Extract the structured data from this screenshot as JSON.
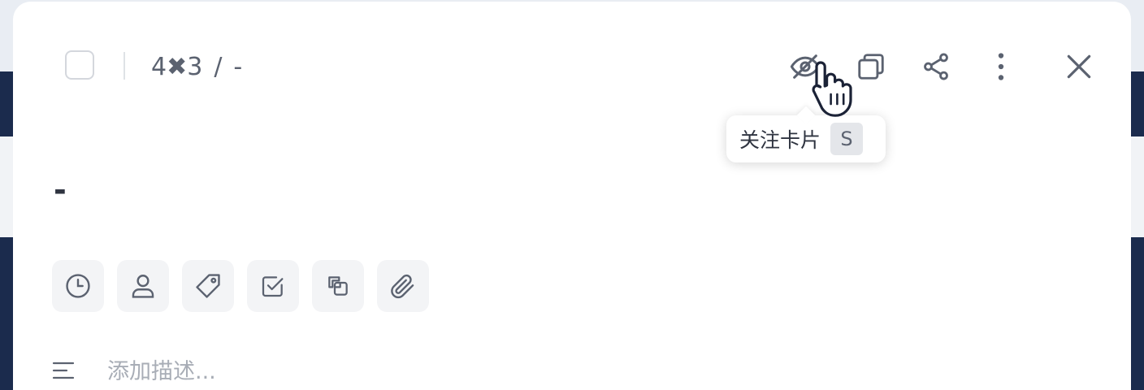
{
  "header": {
    "dimensions": "4✖3",
    "separator": "/",
    "list_name": "-"
  },
  "tooltip": {
    "label": "关注卡片",
    "shortcut": "S"
  },
  "card": {
    "title": "-"
  },
  "description": {
    "placeholder": "添加描述..."
  },
  "icons": {
    "header": [
      "eye-off-icon",
      "copy-icon",
      "share-icon",
      "more-vertical-icon",
      "close-icon"
    ],
    "actions": [
      "clock-icon",
      "user-icon",
      "tag-icon",
      "checklist-icon",
      "link-card-icon",
      "attachment-icon"
    ]
  },
  "colors": {
    "icon": "#5b6270",
    "button_bg": "#f3f4f6",
    "backdrop": "#1b2b4d"
  }
}
